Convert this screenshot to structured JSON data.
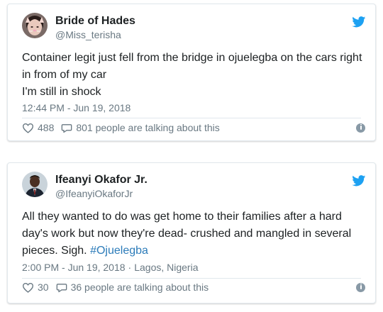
{
  "colors": {
    "twitter_blue": "#1da1f2",
    "hashtag": "#2b7bb9",
    "muted": "#697882",
    "text": "#1c2022"
  },
  "tweets": [
    {
      "author_name": "Bride of Hades",
      "handle": "@Miss_terisha",
      "text_lines": [
        "Container legit just fell from the bridge in ojuelegba on the cars right",
        "in from of my car",
        "I'm still in shock"
      ],
      "timestamp": "12:44 PM - Jun 19, 2018",
      "location": "",
      "likes": "488",
      "talking": "801 people are talking about this",
      "avatar_icon": "woman-cat-filter-avatar",
      "brand_icon": "twitter-bird-icon",
      "like_icon": "heart-icon",
      "reply_icon": "speech-bubble-icon",
      "info_icon": "info-icon"
    },
    {
      "author_name": "Ifeanyi Okafor Jr.",
      "handle": "@IfeanyiOkaforJr",
      "text_lines": [
        "All they wanted to do was get home to their families after a hard",
        "day's work but now they're dead- crushed and mangled in several"
      ],
      "text_last_plain": "pieces. Sigh. ",
      "text_last_hashtag": "#Ojuelegba",
      "timestamp": "2:00 PM - Jun 19, 2018",
      "separator": "·",
      "location": "Lagos, Nigeria",
      "likes": "30",
      "talking": "36 people are talking about this",
      "avatar_icon": "man-in-suit-avatar",
      "brand_icon": "twitter-bird-icon",
      "like_icon": "heart-icon",
      "reply_icon": "speech-bubble-icon",
      "info_icon": "info-icon"
    }
  ]
}
